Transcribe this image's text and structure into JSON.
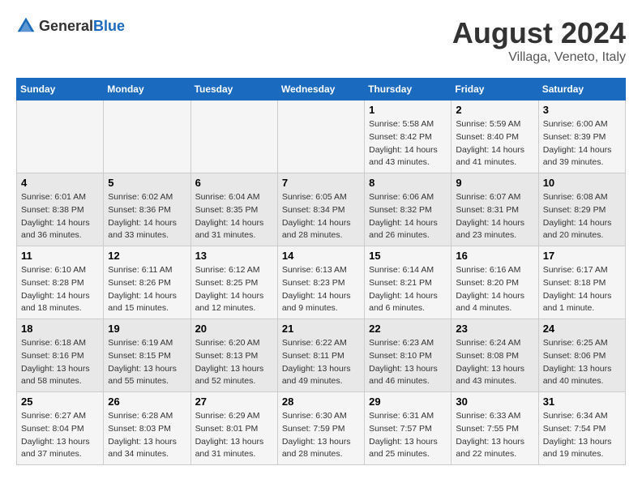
{
  "header": {
    "logo_general": "General",
    "logo_blue": "Blue",
    "month_year": "August 2024",
    "location": "Villaga, Veneto, Italy"
  },
  "calendar": {
    "days_of_week": [
      "Sunday",
      "Monday",
      "Tuesday",
      "Wednesday",
      "Thursday",
      "Friday",
      "Saturday"
    ],
    "weeks": [
      [
        {
          "day": "",
          "info": ""
        },
        {
          "day": "",
          "info": ""
        },
        {
          "day": "",
          "info": ""
        },
        {
          "day": "",
          "info": ""
        },
        {
          "day": "1",
          "info": "Sunrise: 5:58 AM\nSunset: 8:42 PM\nDaylight: 14 hours\nand 43 minutes."
        },
        {
          "day": "2",
          "info": "Sunrise: 5:59 AM\nSunset: 8:40 PM\nDaylight: 14 hours\nand 41 minutes."
        },
        {
          "day": "3",
          "info": "Sunrise: 6:00 AM\nSunset: 8:39 PM\nDaylight: 14 hours\nand 39 minutes."
        }
      ],
      [
        {
          "day": "4",
          "info": "Sunrise: 6:01 AM\nSunset: 8:38 PM\nDaylight: 14 hours\nand 36 minutes."
        },
        {
          "day": "5",
          "info": "Sunrise: 6:02 AM\nSunset: 8:36 PM\nDaylight: 14 hours\nand 33 minutes."
        },
        {
          "day": "6",
          "info": "Sunrise: 6:04 AM\nSunset: 8:35 PM\nDaylight: 14 hours\nand 31 minutes."
        },
        {
          "day": "7",
          "info": "Sunrise: 6:05 AM\nSunset: 8:34 PM\nDaylight: 14 hours\nand 28 minutes."
        },
        {
          "day": "8",
          "info": "Sunrise: 6:06 AM\nSunset: 8:32 PM\nDaylight: 14 hours\nand 26 minutes."
        },
        {
          "day": "9",
          "info": "Sunrise: 6:07 AM\nSunset: 8:31 PM\nDaylight: 14 hours\nand 23 minutes."
        },
        {
          "day": "10",
          "info": "Sunrise: 6:08 AM\nSunset: 8:29 PM\nDaylight: 14 hours\nand 20 minutes."
        }
      ],
      [
        {
          "day": "11",
          "info": "Sunrise: 6:10 AM\nSunset: 8:28 PM\nDaylight: 14 hours\nand 18 minutes."
        },
        {
          "day": "12",
          "info": "Sunrise: 6:11 AM\nSunset: 8:26 PM\nDaylight: 14 hours\nand 15 minutes."
        },
        {
          "day": "13",
          "info": "Sunrise: 6:12 AM\nSunset: 8:25 PM\nDaylight: 14 hours\nand 12 minutes."
        },
        {
          "day": "14",
          "info": "Sunrise: 6:13 AM\nSunset: 8:23 PM\nDaylight: 14 hours\nand 9 minutes."
        },
        {
          "day": "15",
          "info": "Sunrise: 6:14 AM\nSunset: 8:21 PM\nDaylight: 14 hours\nand 6 minutes."
        },
        {
          "day": "16",
          "info": "Sunrise: 6:16 AM\nSunset: 8:20 PM\nDaylight: 14 hours\nand 4 minutes."
        },
        {
          "day": "17",
          "info": "Sunrise: 6:17 AM\nSunset: 8:18 PM\nDaylight: 14 hours\nand 1 minute."
        }
      ],
      [
        {
          "day": "18",
          "info": "Sunrise: 6:18 AM\nSunset: 8:16 PM\nDaylight: 13 hours\nand 58 minutes."
        },
        {
          "day": "19",
          "info": "Sunrise: 6:19 AM\nSunset: 8:15 PM\nDaylight: 13 hours\nand 55 minutes."
        },
        {
          "day": "20",
          "info": "Sunrise: 6:20 AM\nSunset: 8:13 PM\nDaylight: 13 hours\nand 52 minutes."
        },
        {
          "day": "21",
          "info": "Sunrise: 6:22 AM\nSunset: 8:11 PM\nDaylight: 13 hours\nand 49 minutes."
        },
        {
          "day": "22",
          "info": "Sunrise: 6:23 AM\nSunset: 8:10 PM\nDaylight: 13 hours\nand 46 minutes."
        },
        {
          "day": "23",
          "info": "Sunrise: 6:24 AM\nSunset: 8:08 PM\nDaylight: 13 hours\nand 43 minutes."
        },
        {
          "day": "24",
          "info": "Sunrise: 6:25 AM\nSunset: 8:06 PM\nDaylight: 13 hours\nand 40 minutes."
        }
      ],
      [
        {
          "day": "25",
          "info": "Sunrise: 6:27 AM\nSunset: 8:04 PM\nDaylight: 13 hours\nand 37 minutes."
        },
        {
          "day": "26",
          "info": "Sunrise: 6:28 AM\nSunset: 8:03 PM\nDaylight: 13 hours\nand 34 minutes."
        },
        {
          "day": "27",
          "info": "Sunrise: 6:29 AM\nSunset: 8:01 PM\nDaylight: 13 hours\nand 31 minutes."
        },
        {
          "day": "28",
          "info": "Sunrise: 6:30 AM\nSunset: 7:59 PM\nDaylight: 13 hours\nand 28 minutes."
        },
        {
          "day": "29",
          "info": "Sunrise: 6:31 AM\nSunset: 7:57 PM\nDaylight: 13 hours\nand 25 minutes."
        },
        {
          "day": "30",
          "info": "Sunrise: 6:33 AM\nSunset: 7:55 PM\nDaylight: 13 hours\nand 22 minutes."
        },
        {
          "day": "31",
          "info": "Sunrise: 6:34 AM\nSunset: 7:54 PM\nDaylight: 13 hours\nand 19 minutes."
        }
      ]
    ]
  }
}
